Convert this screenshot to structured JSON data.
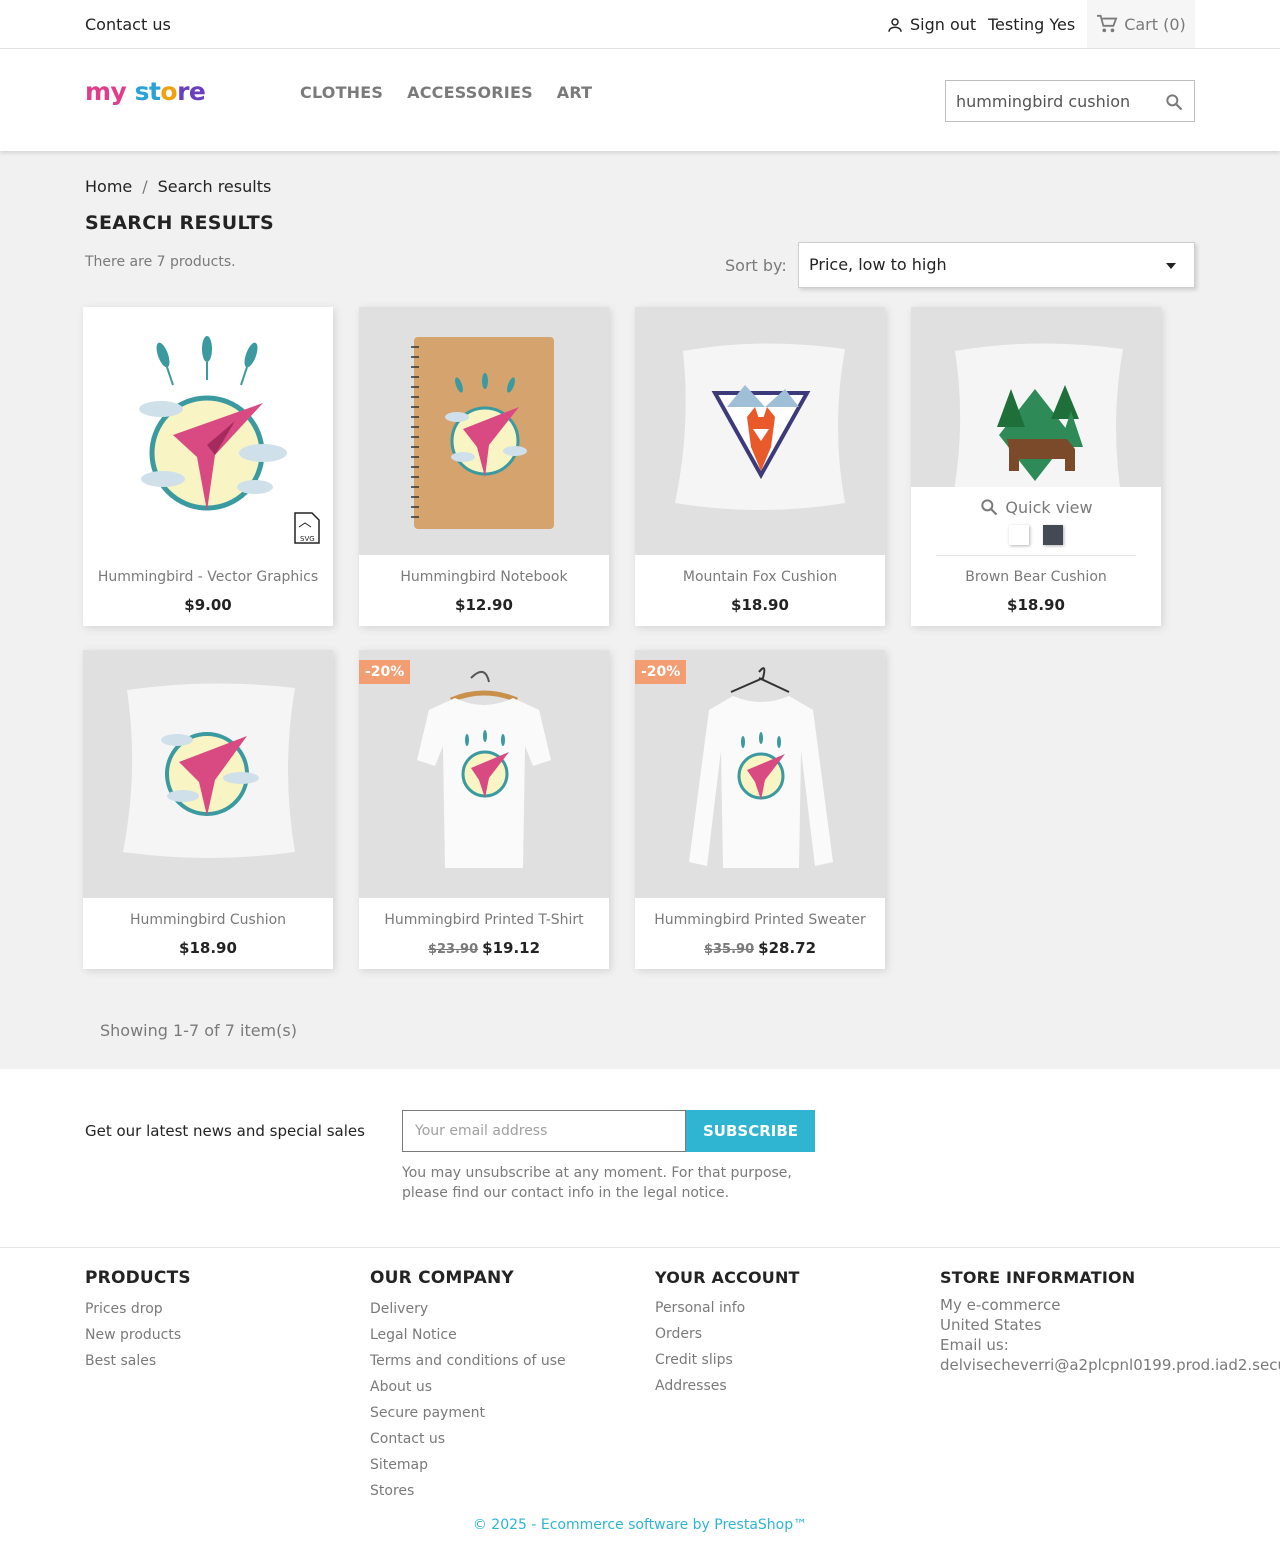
{
  "header": {
    "contact": "Contact us",
    "signout": "Sign out",
    "user": "Testing Yes",
    "cart": "Cart (0)"
  },
  "logo": {
    "part1": "my ",
    "part2": "st",
    "part3": "o",
    "part4": "re"
  },
  "nav": [
    "CLOTHES",
    "ACCESSORIES",
    "ART"
  ],
  "search": {
    "value": "hummingbird cushion"
  },
  "breadcrumb": {
    "home": "Home",
    "sep": "/",
    "current": "Search results"
  },
  "page": {
    "title": "SEARCH RESULTS",
    "count": "There are 7 products.",
    "sort_label": "Sort by:",
    "sort_value": "Price, low to high",
    "showing": "Showing 1-7 of 7 item(s)"
  },
  "products": [
    {
      "name": "Hummingbird - Vector Graphics",
      "price": "$9.00"
    },
    {
      "name": "Hummingbird Notebook",
      "price": "$12.90"
    },
    {
      "name": "Mountain Fox Cushion",
      "price": "$18.90"
    },
    {
      "name": "Brown Bear Cushion",
      "price": "$18.90",
      "quick_view": "Quick view",
      "swatch_colors": [
        "#ffffff",
        "#434a54"
      ]
    },
    {
      "name": "Hummingbird Cushion",
      "price": "$18.90"
    },
    {
      "name": "Hummingbird Printed T-Shirt",
      "old_price": "$23.90",
      "price": "$19.12",
      "badge": "-20%"
    },
    {
      "name": "Hummingbird Printed Sweater",
      "old_price": "$35.90",
      "price": "$28.72",
      "badge": "-20%"
    }
  ],
  "newsletter": {
    "text": "Get our latest news and special sales",
    "placeholder": "Your email address",
    "button": "SUBSCRIBE",
    "note": "You may unsubscribe at any moment. For that purpose, please find our contact info in the legal notice."
  },
  "footer": {
    "products": {
      "title": "PRODUCTS",
      "links": [
        "Prices drop",
        "New products",
        "Best sales"
      ]
    },
    "company": {
      "title": "OUR COMPANY",
      "links": [
        "Delivery",
        "Legal Notice",
        "Terms and conditions of use",
        "About us",
        "Secure payment",
        "Contact us",
        "Sitemap",
        "Stores"
      ]
    },
    "account": {
      "title": "YOUR ACCOUNT",
      "links": [
        "Personal info",
        "Orders",
        "Credit slips",
        "Addresses"
      ]
    },
    "store": {
      "title": "STORE INFORMATION",
      "lines": [
        "My e-commerce",
        "United States",
        "Email us:",
        "delvisecheverri@a2plcpnl0199.prod.iad2.secu"
      ]
    },
    "copyright": "© 2025 - Ecommerce software by PrestaShop™"
  },
  "colors": {
    "accent": "#2fb5d2",
    "badge": "#f39d72"
  }
}
